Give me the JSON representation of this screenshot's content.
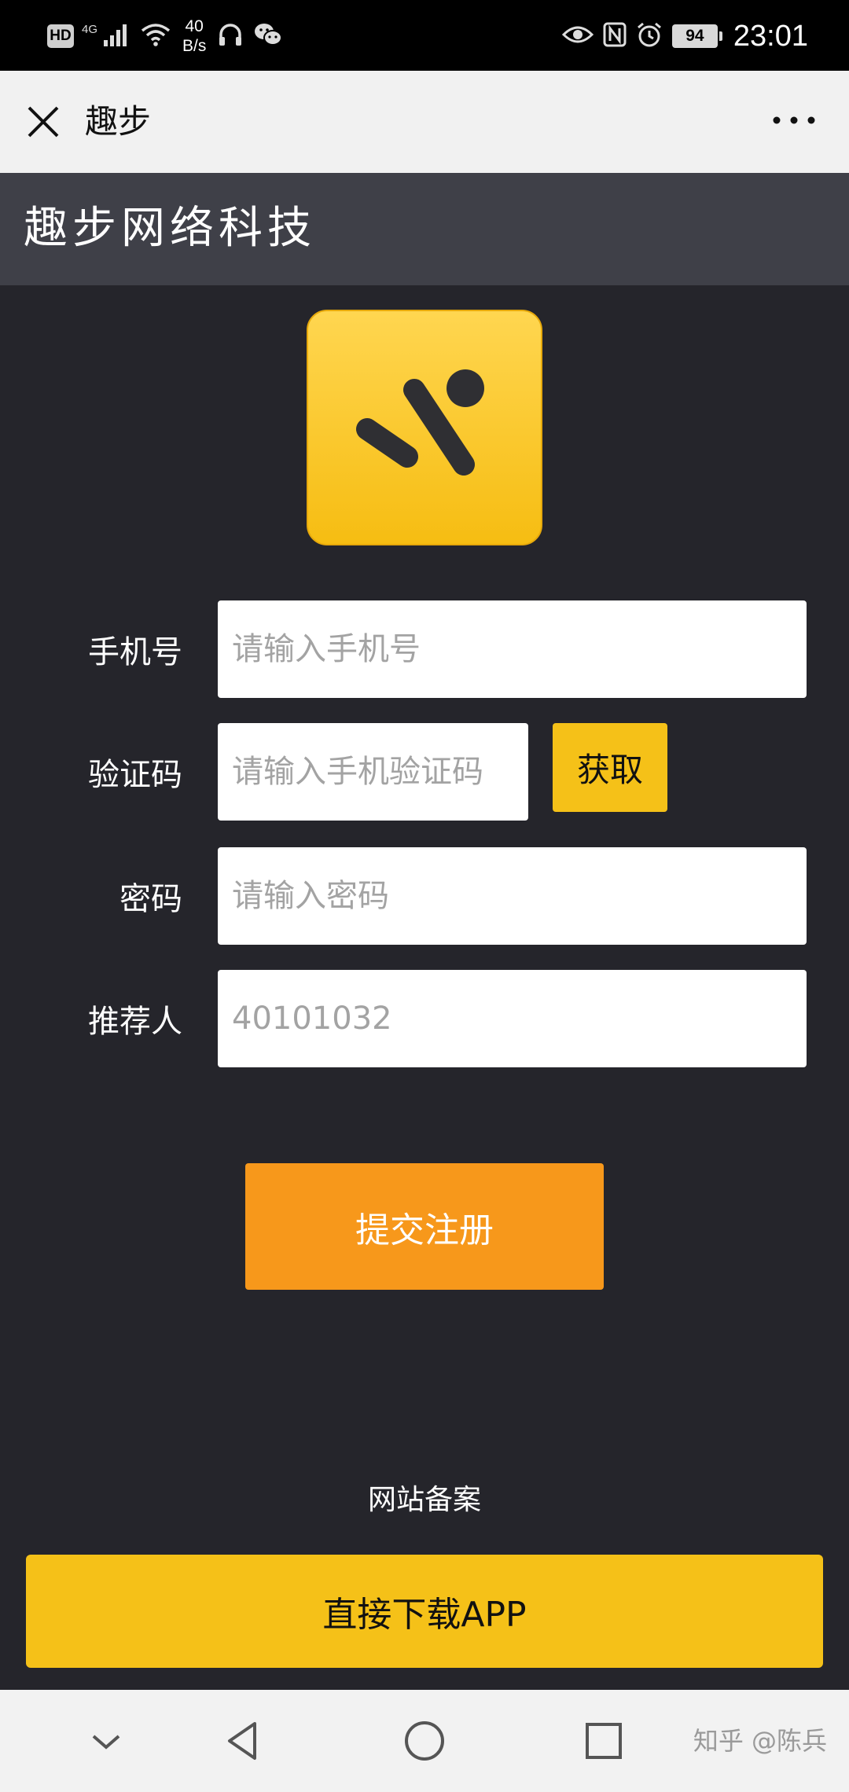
{
  "status_bar": {
    "hd_badge": "HD",
    "network_type": "4G",
    "speed_value": "40",
    "speed_unit": "B/s",
    "battery_level": "94",
    "time": "23:01",
    "left_icons": [
      "signal-icon",
      "wifi-icon",
      "headphones-icon",
      "wechat-icon"
    ],
    "right_icons": [
      "eye-icon",
      "nfc-icon",
      "alarm-icon",
      "battery-icon"
    ]
  },
  "nav_bar": {
    "title": "趣步",
    "close_icon": "close-icon",
    "more_icon": "more-icon"
  },
  "header": {
    "title": "趣步网络科技"
  },
  "logo": {
    "icon": "runner-logo-icon",
    "colors": {
      "top": "#ffd650",
      "bottom": "#f6bd12",
      "mark": "#2f2f33"
    }
  },
  "form": {
    "phone": {
      "label": "手机号",
      "placeholder": "请输入手机号"
    },
    "code": {
      "label": "验证码",
      "placeholder": "请输入手机验证码",
      "button": "获取"
    },
    "password": {
      "label": "密码",
      "placeholder": "请输入密码"
    },
    "referrer": {
      "label": "推荐人",
      "placeholder": "40101032"
    }
  },
  "submit_label": "提交注册",
  "icp_label": "网站备案",
  "download_label": "直接下载APP",
  "system_nav": {
    "icons": [
      "chevron-down-icon",
      "back-icon",
      "home-icon",
      "recents-icon"
    ],
    "watermark": "知乎 @陈兵"
  },
  "colors": {
    "page_bg": "#25252b",
    "header_bg": "#3f4048",
    "accent_yellow": "#f5c118",
    "accent_orange": "#f7981b"
  }
}
